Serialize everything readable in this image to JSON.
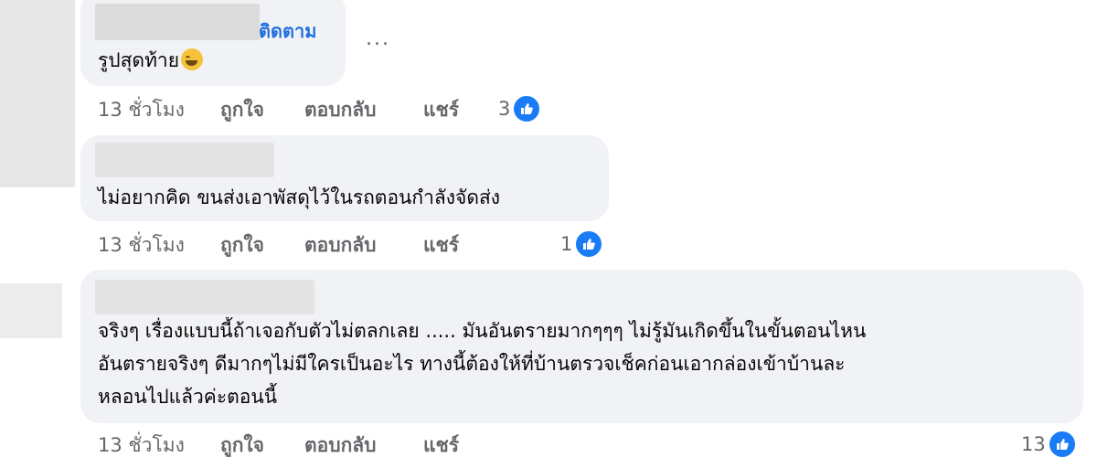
{
  "comments": [
    {
      "follow_label": "ติดตาม",
      "text": "รูปสุดท้าย",
      "emoji": "grinning-sweat-emoji",
      "more_label": "...",
      "time": "13 ชั่วโมง",
      "like_label": "ถูกใจ",
      "reply_label": "ตอบกลับ",
      "share_label": "แชร์",
      "reaction_count": "3"
    },
    {
      "text": "ไม่อยากคิด ขนส่งเอาพัสดุไว้ในรถตอนกำลังจัดส่ง",
      "time": "13 ชั่วโมง",
      "like_label": "ถูกใจ",
      "reply_label": "ตอบกลับ",
      "share_label": "แชร์",
      "reaction_count": "1"
    },
    {
      "lines": [
        "จริงๆ เรื่องแบบนี้ถ้าเจอกับตัวไม่ตลกเลย ..... มันอันตรายมากๆๆๆ ไม่รู้มันเกิดขึ้นในขั้นตอนไหน",
        "อันตรายจริงๆ ดีมากๆไม่มีใครเป็นอะไร ทางนี้ต้องให้ที่บ้านตรวจเช็คก่อนเอากล่องเข้าบ้านละ",
        "หลอนไปแล้วค่ะตอนนี้"
      ],
      "time": "13 ชั่วโมง",
      "like_label": "ถูกใจ",
      "reply_label": "ตอบกลับ",
      "share_label": "แชร์",
      "reaction_count": "13"
    }
  ],
  "colors": {
    "bubble": "#f0f2f5",
    "link": "#216fdb",
    "meta": "#65676b",
    "like": "#1a7cf5"
  }
}
